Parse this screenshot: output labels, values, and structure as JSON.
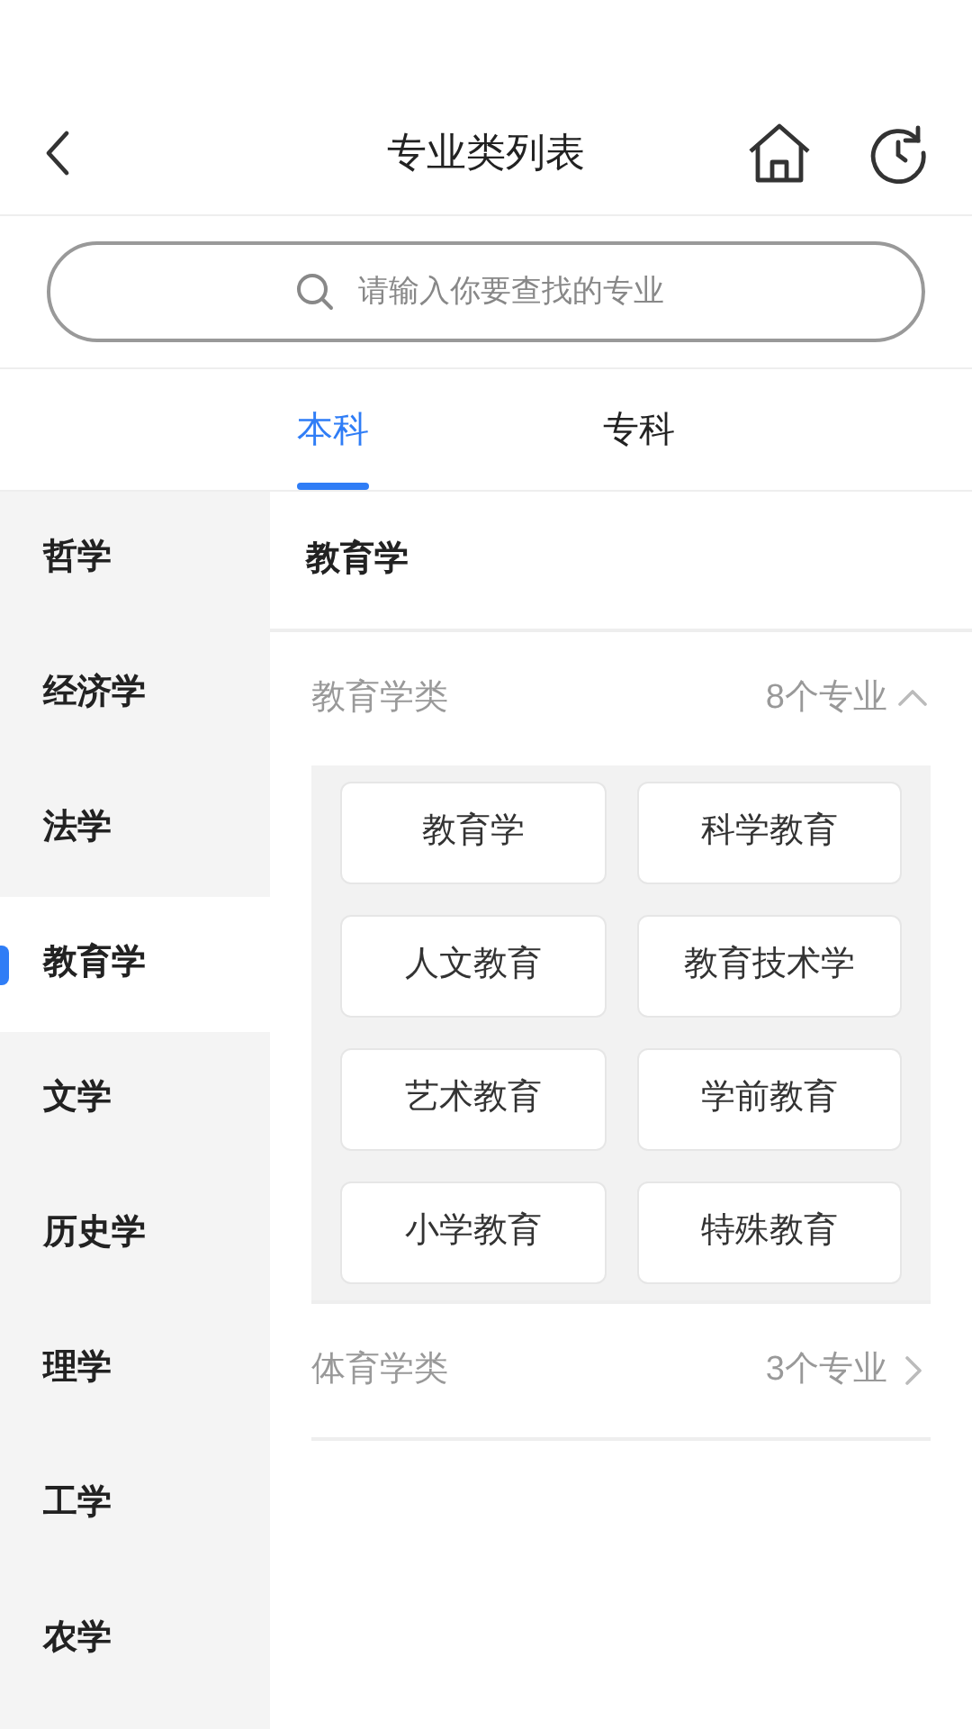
{
  "header": {
    "title": "专业类列表"
  },
  "search": {
    "placeholder": "请输入你要查找的专业"
  },
  "tabs": [
    {
      "label": "本科",
      "selected": true
    },
    {
      "label": "专科",
      "selected": false
    }
  ],
  "sidebar": {
    "items": [
      {
        "label": "哲学",
        "selected": false
      },
      {
        "label": "经济学",
        "selected": false
      },
      {
        "label": "法学",
        "selected": false
      },
      {
        "label": "教育学",
        "selected": true
      },
      {
        "label": "文学",
        "selected": false
      },
      {
        "label": "历史学",
        "selected": false
      },
      {
        "label": "理学",
        "selected": false
      },
      {
        "label": "工学",
        "selected": false
      },
      {
        "label": "农学",
        "selected": false
      }
    ]
  },
  "content": {
    "title": "教育学",
    "groups": [
      {
        "name": "教育学类",
        "count": "8个专业",
        "expanded": true,
        "majors": [
          "教育学",
          "科学教育",
          "人文教育",
          "教育技术学",
          "艺术教育",
          "学前教育",
          "小学教育",
          "特殊教育"
        ]
      },
      {
        "name": "体育学类",
        "count": "3个专业",
        "expanded": false
      }
    ]
  }
}
